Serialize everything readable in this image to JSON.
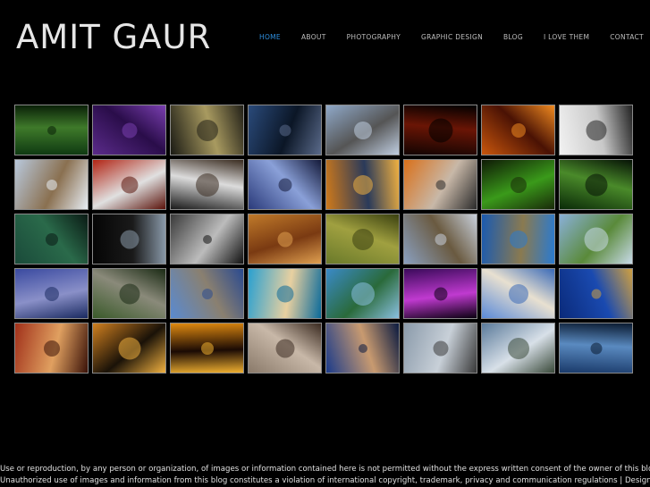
{
  "site": {
    "logo": "AMIT GAUR"
  },
  "nav": {
    "items": [
      "HOME",
      "ABOUT",
      "PHOTOGRAPHY",
      "GRAPHIC DESIGN",
      "BLOG",
      "I LOVE THEM",
      "CONTACT"
    ],
    "active": "HOME"
  },
  "gallery": {
    "thumbnails": [
      {
        "name": "forest-trees",
        "colors": [
          "#0f3a12",
          "#3f7a2a",
          "#0a2008"
        ]
      },
      {
        "name": "purple-tree-silhouette",
        "colors": [
          "#5a2b8a",
          "#2a0d4a",
          "#7a3fb0"
        ]
      },
      {
        "name": "cloudy-sky",
        "colors": [
          "#1a1a14",
          "#a89a60",
          "#222018"
        ]
      },
      {
        "name": "tree-at-dusk",
        "colors": [
          "#2a4a7a",
          "#0b1626",
          "#5a6a8a"
        ]
      },
      {
        "name": "dam-wall",
        "colors": [
          "#8fa8c8",
          "#555",
          "#bfcde0"
        ]
      },
      {
        "name": "red-sun",
        "colors": [
          "#120402",
          "#6a1505",
          "#000"
        ]
      },
      {
        "name": "orange-sunset",
        "colors": [
          "#c9560c",
          "#4a1204",
          "#f08a20"
        ]
      },
      {
        "name": "people-silhouettes",
        "colors": [
          "#f2f2f2",
          "#c8c8c8",
          "#222"
        ]
      },
      {
        "name": "palace-ruins",
        "colors": [
          "#b8c8dc",
          "#8a7050",
          "#e8eef5"
        ]
      },
      {
        "name": "red-door",
        "colors": [
          "#b22414",
          "#e0e0e0",
          "#5a120a"
        ]
      },
      {
        "name": "checkered-floor",
        "colors": [
          "#1a1a1a",
          "#dcdcdc",
          "#3a2c20"
        ]
      },
      {
        "name": "blue-lake",
        "colors": [
          "#2a3a7a",
          "#8aa0d8",
          "#141a3a"
        ]
      },
      {
        "name": "pier-sunset",
        "colors": [
          "#d07a1a",
          "#2a3a5a",
          "#f0b040"
        ]
      },
      {
        "name": "turban-man",
        "colors": [
          "#d9701a",
          "#c8b8a8",
          "#2a2a2a"
        ]
      },
      {
        "name": "green-parrot",
        "colors": [
          "#0f1a06",
          "#3a9a1a",
          "#1a2a0a"
        ]
      },
      {
        "name": "water-drop-leaf",
        "colors": [
          "#0a2a08",
          "#4a8a2a",
          "#061206"
        ]
      },
      {
        "name": "crow-on-branch",
        "colors": [
          "#1a4a3a",
          "#2a6a4a",
          "#0a1a14"
        ]
      },
      {
        "name": "moon-bird",
        "colors": [
          "#050505",
          "#1a1a1a",
          "#8a9aaa"
        ]
      },
      {
        "name": "child-portrait",
        "colors": [
          "#3a3a3a",
          "#bcbcbc",
          "#111"
        ]
      },
      {
        "name": "candles-woman",
        "colors": [
          "#c07a2a",
          "#7a3a12",
          "#e0a050"
        ]
      },
      {
        "name": "white-birds",
        "colors": [
          "#6a7a2a",
          "#a0a040",
          "#3a4010"
        ]
      },
      {
        "name": "mountain-valley",
        "colors": [
          "#8aa0c0",
          "#6a5a40",
          "#c8d0dc"
        ]
      },
      {
        "name": "blue-mountains",
        "colors": [
          "#1a5ab0",
          "#8a7a50",
          "#2a7ad0"
        ]
      },
      {
        "name": "lone-tree-field",
        "colors": [
          "#8ab0d8",
          "#5a8a3a",
          "#c8dae8"
        ]
      },
      {
        "name": "hills-blue",
        "colors": [
          "#3a4aa0",
          "#8a90c8",
          "#1a2a60"
        ]
      },
      {
        "name": "monastery-cliff",
        "colors": [
          "#3a5a2a",
          "#8a8a7a",
          "#1a2a14"
        ]
      },
      {
        "name": "temple-sky",
        "colors": [
          "#5a8ad0",
          "#8a8070",
          "#2a4a90"
        ]
      },
      {
        "name": "beach-umbrella",
        "colors": [
          "#2aa0d0",
          "#e8d0a0",
          "#0a6a9a"
        ]
      },
      {
        "name": "resort-pool",
        "colors": [
          "#3a8ac8",
          "#2a6a3a",
          "#8ac0e0"
        ]
      },
      {
        "name": "purple-dancer",
        "colors": [
          "#3a0a5a",
          "#c03ad0",
          "#0a0010"
        ]
      },
      {
        "name": "taj-mahal",
        "colors": [
          "#5a8ad8",
          "#e8e0d0",
          "#3a6ab8"
        ]
      },
      {
        "name": "night-city",
        "colors": [
          "#0a2a7a",
          "#1a4ab0",
          "#d0a040"
        ]
      },
      {
        "name": "monk-prayer",
        "colors": [
          "#a0301a",
          "#e0a060",
          "#3a1208"
        ]
      },
      {
        "name": "river-statue-sunset",
        "colors": [
          "#d08020",
          "#1a1208",
          "#f0b040"
        ]
      },
      {
        "name": "palm-sunset",
        "colors": [
          "#e08a10",
          "#1a0a04",
          "#f0b030"
        ]
      },
      {
        "name": "carved-stone",
        "colors": [
          "#8a7a6a",
          "#c8b8a8",
          "#3a2a20"
        ]
      },
      {
        "name": "boy-portrait",
        "colors": [
          "#1a3a8a",
          "#c89a70",
          "#0a1a40"
        ]
      },
      {
        "name": "mist-rocks",
        "colors": [
          "#8a9aaa",
          "#c8d0d8",
          "#3a3a3a"
        ]
      },
      {
        "name": "mountain-stream",
        "colors": [
          "#5a7a9a",
          "#d8e0e8",
          "#3a4a3a"
        ]
      },
      {
        "name": "stormy-sky",
        "colors": [
          "#1a3a6a",
          "#5a8ac0",
          "#0a1a30"
        ]
      }
    ]
  },
  "footer": {
    "line1": "Use or reproduction, by any person or organization, of images or information contained here is not permitted without the express written consent of the owner of this blog.",
    "line2": "Unauthorized use of images and information from this blog constitutes a violation of international copyright, trademark, privacy and communication regulations | Designed by"
  }
}
